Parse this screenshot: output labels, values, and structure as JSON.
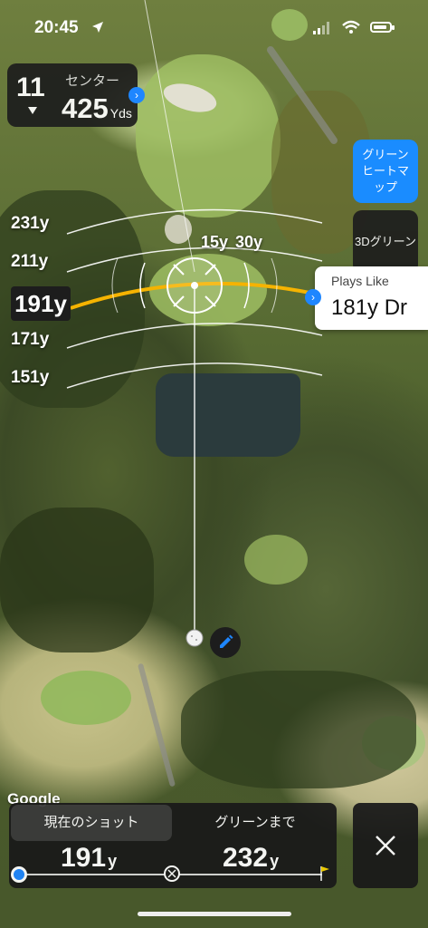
{
  "status": {
    "time": "20:45"
  },
  "hole": {
    "number": "11",
    "distance_label": "センター",
    "distance_value": "425",
    "distance_unit": "Yds"
  },
  "buttons": {
    "heatmap": "グリーンヒートマップ",
    "green3d": "3Dグリーン"
  },
  "plays_like": {
    "label": "Plays Like",
    "value": "181y Dr"
  },
  "yardage_rings": [
    "231y",
    "211y",
    "191y",
    "171y",
    "151y"
  ],
  "scale_labels": [
    "15y",
    "30y"
  ],
  "map_attribution": "Google",
  "bottom_panel": {
    "current_shot_tab": "現在のショット",
    "to_green_tab": "グリーンまで",
    "shot_distance": "191",
    "green_distance": "232",
    "unit": "y"
  },
  "colors": {
    "accent_blue": "#1a8cff",
    "arc_yellow": "#f5b301",
    "panel_dark": "#1a1a1a"
  },
  "icons": [
    "location-arrow-icon",
    "signal-icon",
    "wifi-icon",
    "battery-icon",
    "chevron-down-icon",
    "chevron-right-icon",
    "crosshair-icon",
    "golf-ball-icon",
    "pencil-icon",
    "target-icon",
    "flag-icon",
    "close-icon"
  ]
}
